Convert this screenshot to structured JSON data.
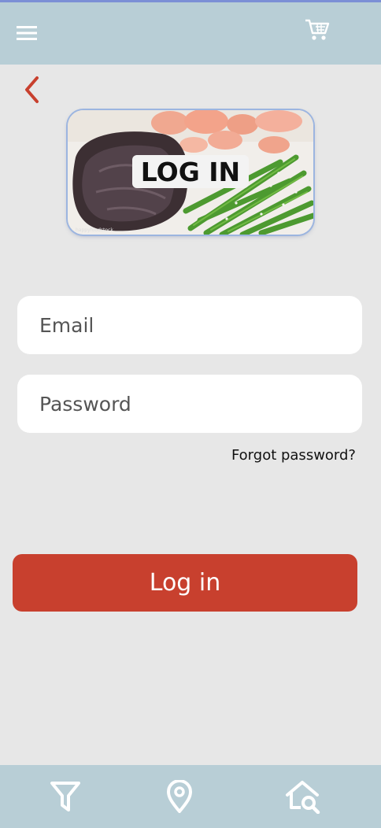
{
  "header": {
    "menu_icon": "hamburger-menu-icon",
    "cart_icon": "shopping-cart-icon"
  },
  "nav": {
    "back_icon": "chevron-left-icon"
  },
  "hero": {
    "title": "LOG IN",
    "watermark": "happyfoodstock"
  },
  "form": {
    "email_placeholder": "Email",
    "password_placeholder": "Password",
    "forgot_label": "Forgot password?",
    "login_label": "Log in"
  },
  "bottom_nav": {
    "filter_icon": "filter-funnel-icon",
    "location_icon": "location-pin-icon",
    "home_search_icon": "home-search-icon"
  },
  "colors": {
    "bar": "#b8ced6",
    "background": "#e7e7e7",
    "accent": "#c8402e",
    "back_arrow": "#c8402e",
    "top_accent": "#7b8fd6"
  }
}
